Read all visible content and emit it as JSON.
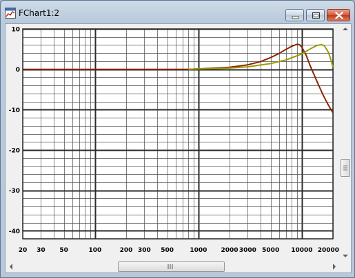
{
  "window": {
    "title": "FChart1:2",
    "icon": "chart-app-icon",
    "buttons": [
      "minimize-icon",
      "maximize-icon",
      "close-icon"
    ]
  },
  "colors": {
    "grid": "#4a4a4a",
    "grid_major": "#2b2b2b",
    "plot_bg": "#ffffff",
    "series_red": "#8b2500",
    "series_olive": "#9a9a00"
  },
  "chart_data": {
    "type": "line",
    "x_scale": "log",
    "xlim": [
      20,
      20000
    ],
    "ylim": [
      -42,
      10
    ],
    "grid": true,
    "x_tick_labels": [
      "20",
      "30",
      "50",
      "100",
      "200",
      "300",
      "500",
      "1000",
      "2000",
      "3000",
      "5000",
      "10000",
      "20000"
    ],
    "x_tick_values": [
      20,
      30,
      50,
      100,
      200,
      300,
      500,
      1000,
      2000,
      3000,
      5000,
      10000,
      20000
    ],
    "y_tick_labels": [
      "10",
      "0",
      "-10",
      "-20",
      "-30",
      "-40"
    ],
    "y_tick_values": [
      10,
      0,
      -10,
      -20,
      -30,
      -40
    ],
    "series": [
      {
        "color": "#8b2500",
        "x": [
          20,
          100,
          500,
          800,
          1000,
          2000,
          3000,
          4000,
          5000,
          6000,
          7000,
          8000,
          9000,
          9500,
          10000,
          11000,
          12000,
          14000,
          16000,
          18000,
          20000
        ],
        "y": [
          0,
          0,
          0,
          0,
          0.1,
          0.5,
          1.1,
          1.9,
          2.9,
          3.9,
          4.9,
          5.7,
          6.2,
          6.1,
          5.5,
          3.5,
          1.0,
          -3.0,
          -6.3,
          -8.8,
          -10.8
        ]
      },
      {
        "color": "#9a9a00",
        "x": [
          800,
          1000,
          2000,
          3000,
          5000,
          7000,
          10000,
          12000,
          14000,
          15500,
          16500,
          18000,
          19000,
          20000
        ],
        "y": [
          0,
          0.1,
          0.3,
          0.6,
          1.4,
          2.3,
          3.8,
          5.0,
          5.9,
          6.1,
          5.8,
          4.3,
          2.6,
          0.5
        ]
      }
    ]
  },
  "scrollbars": {
    "horizontal_grip": "III",
    "vertical_grip": "="
  }
}
